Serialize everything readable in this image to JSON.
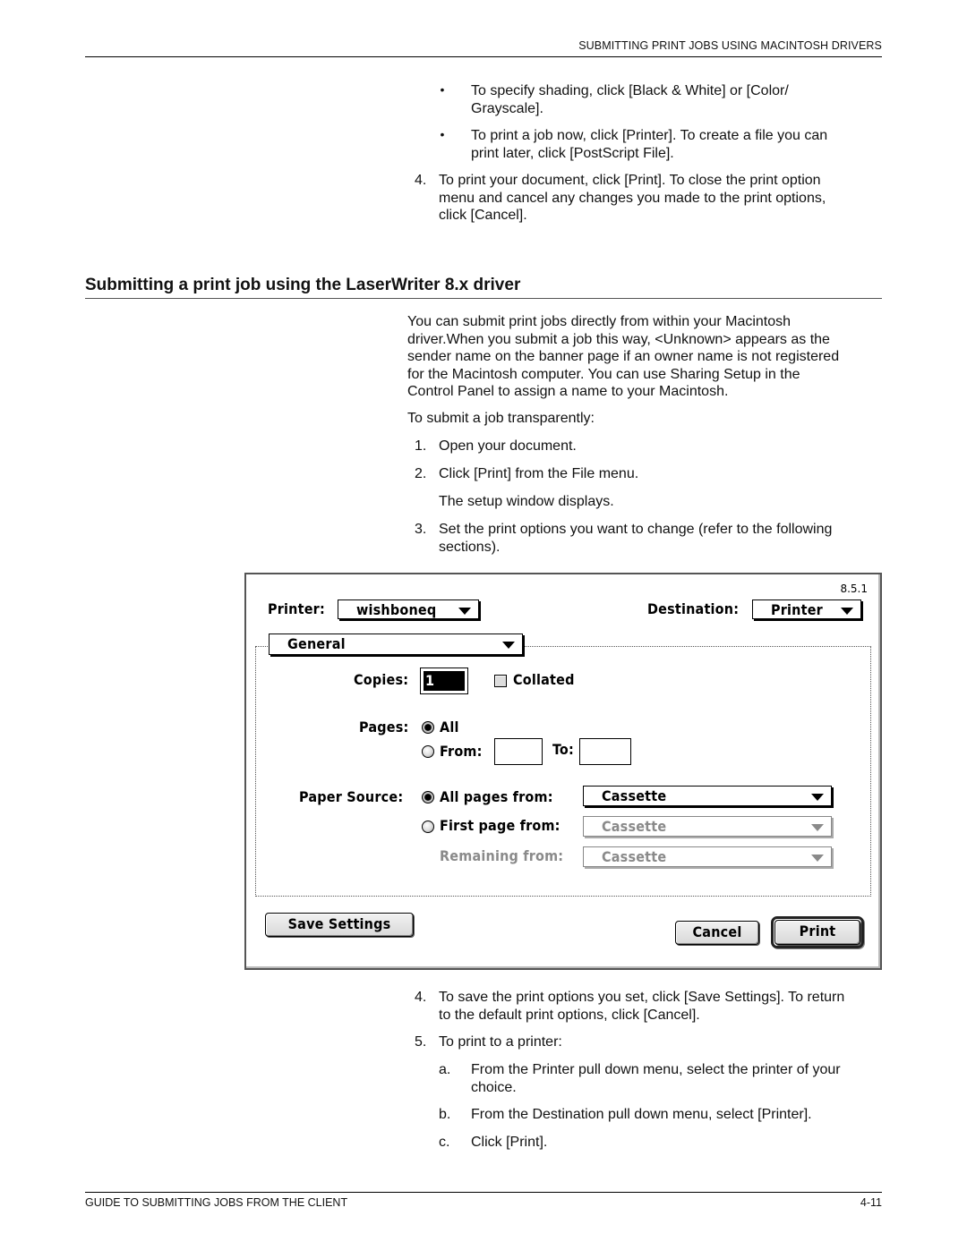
{
  "header": {
    "running_head": "SUBMITTING PRINT JOBS USING MACINTOSH DRIVERS"
  },
  "top_section": {
    "bullets": [
      {
        "symbol": "•",
        "lines": [
          "To specify shading, click [Black & White] or [Color/",
          "Grayscale]."
        ]
      },
      {
        "symbol": "•",
        "lines": [
          "To print a job now, click [Printer]. To create a file you can",
          "print later, click [PostScript File]."
        ]
      }
    ],
    "step4": {
      "num": "4.",
      "lines": [
        "To print your document, click [Print]. To close the print option",
        "menu and cancel any changes you made to the print options,",
        "click [Cancel]."
      ]
    }
  },
  "section": {
    "heading": "Submitting a print job using the LaserWriter 8.x driver",
    "intro_lines": [
      "You can submit print jobs directly from within your Macintosh",
      "driver.When you submit a job this way, <Unknown> appears as the",
      "sender name on the banner page if an owner name is not registered",
      "for the Macintosh computer. You can use Sharing Setup in the",
      "Control Panel to assign a name to your Macintosh."
    ],
    "lead_in": "To submit a job transparently:",
    "steps": [
      {
        "num": "1.",
        "lines": [
          "Open your document."
        ]
      },
      {
        "num": "2.",
        "lines": [
          "Click [Print] from the File menu."
        ],
        "note": "The setup window displays."
      },
      {
        "num": "3.",
        "lines": [
          "Set the print options you want to change (refer to the following",
          "sections)."
        ]
      }
    ]
  },
  "dialog": {
    "version": "8.5.1",
    "printer_label": "Printer:",
    "printer_value": "wishboneq",
    "destination_label": "Destination:",
    "destination_value": "Printer",
    "panel_value": "General",
    "copies_label": "Copies:",
    "copies_value": "1",
    "collated_label": "Collated",
    "collated_checked": false,
    "pages_label": "Pages:",
    "pages_all": "All",
    "pages_from": "From:",
    "pages_to": "To:",
    "pages_from_value": "",
    "pages_to_value": "",
    "pages_selected": "All",
    "paper_source_label": "Paper Source:",
    "all_pages_from": "All pages from:",
    "all_pages_value": "Cassette",
    "first_page_from": "First page from:",
    "first_page_value": "Cassette",
    "remaining_from": "Remaining from:",
    "remaining_value": "Cassette",
    "paper_selected": "All pages from",
    "save_settings": "Save Settings",
    "cancel": "Cancel",
    "print": "Print"
  },
  "after_steps": [
    {
      "num": "4.",
      "lines": [
        "To save the print options you set, click [Save Settings]. To return",
        "to the default print options, click [Cancel]."
      ]
    },
    {
      "num": "5.",
      "lines": [
        "To print to a printer:"
      ]
    }
  ],
  "substeps": [
    {
      "num": "a.",
      "lines": [
        "From the Printer pull down menu, select the printer of your",
        "choice."
      ]
    },
    {
      "num": "b.",
      "lines": [
        "From the Destination pull down menu, select [Printer]."
      ]
    },
    {
      "num": "c.",
      "lines": [
        "Click [Print]."
      ]
    }
  ],
  "footer": {
    "title": "GUIDE TO SUBMITTING JOBS FROM THE CLIENT",
    "page": "4-11"
  }
}
